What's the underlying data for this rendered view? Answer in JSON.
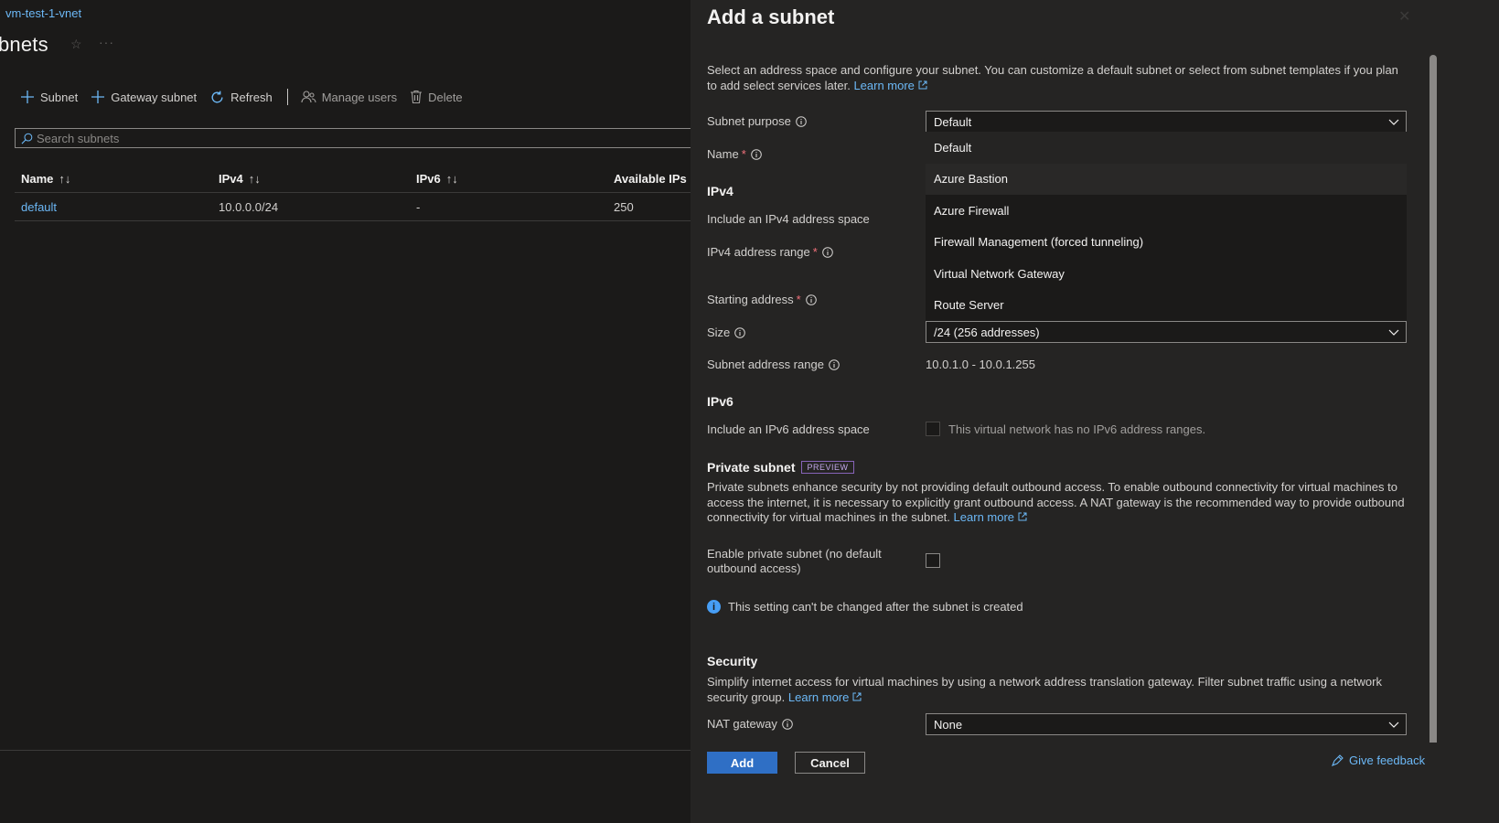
{
  "left": {
    "breadcrumb": "vm-test-1-vnet",
    "title": "bnets",
    "toolbar": {
      "subnet": "Subnet",
      "gateway_subnet": "Gateway subnet",
      "refresh": "Refresh",
      "manage_users": "Manage users",
      "delete": "Delete"
    },
    "search_placeholder": "Search subnets",
    "grid": {
      "columns": [
        "Name",
        "IPv4",
        "IPv6",
        "Available IPs"
      ],
      "rows": [
        {
          "name": "default",
          "ipv4": "10.0.0.0/24",
          "ipv6": "-",
          "available": "250"
        }
      ]
    }
  },
  "panel": {
    "title": "Add a subnet",
    "description": "Select an address space and configure your subnet. You can customize a default subnet or select from subnet templates if you plan to add select services later.",
    "learn_more": "Learn more",
    "subnet_purpose": {
      "label": "Subnet purpose",
      "value": "Default",
      "options": [
        "Default",
        "Azure Bastion",
        "Azure Firewall",
        "Firewall Management (forced tunneling)",
        "Virtual Network Gateway",
        "Route Server"
      ]
    },
    "name_label": "Name",
    "ipv4_heading": "IPv4",
    "include_ipv4_label": "Include an IPv4 address space",
    "ipv4_range_label": "IPv4 address range",
    "starting_address_label": "Starting address",
    "size": {
      "label": "Size",
      "value": "/24 (256 addresses)"
    },
    "subnet_range": {
      "label": "Subnet address range",
      "value": "10.0.1.0 - 10.0.1.255"
    },
    "ipv6_heading": "IPv6",
    "include_ipv6_label": "Include an IPv6 address space",
    "ipv6_note": "This virtual network has no IPv6 address ranges.",
    "private_subnet": {
      "title": "Private subnet",
      "badge": "PREVIEW",
      "description": "Private subnets enhance security by not providing default outbound access. To enable outbound connectivity for virtual machines to access the internet, it is necessary to explicitly grant outbound access. A NAT gateway is the recommended way to provide outbound connectivity for virtual machines in the subnet.",
      "learn_more": "Learn more",
      "enable_label": "Enable private subnet (no default outbound access)",
      "info": "This setting can't be changed after the subnet is created"
    },
    "security": {
      "heading": "Security",
      "description": "Simplify internet access for virtual machines by using a network address translation gateway. Filter subnet traffic using a network security group.",
      "learn_more": "Learn more"
    },
    "nat_gateway": {
      "label": "NAT gateway",
      "value": "None"
    },
    "footer": {
      "add": "Add",
      "cancel": "Cancel",
      "feedback": "Give feedback"
    }
  },
  "colors": {
    "accent": "#2f6fc5",
    "link": "#6cb8f6",
    "preview": "#8764b8",
    "required": "#f1707b"
  }
}
